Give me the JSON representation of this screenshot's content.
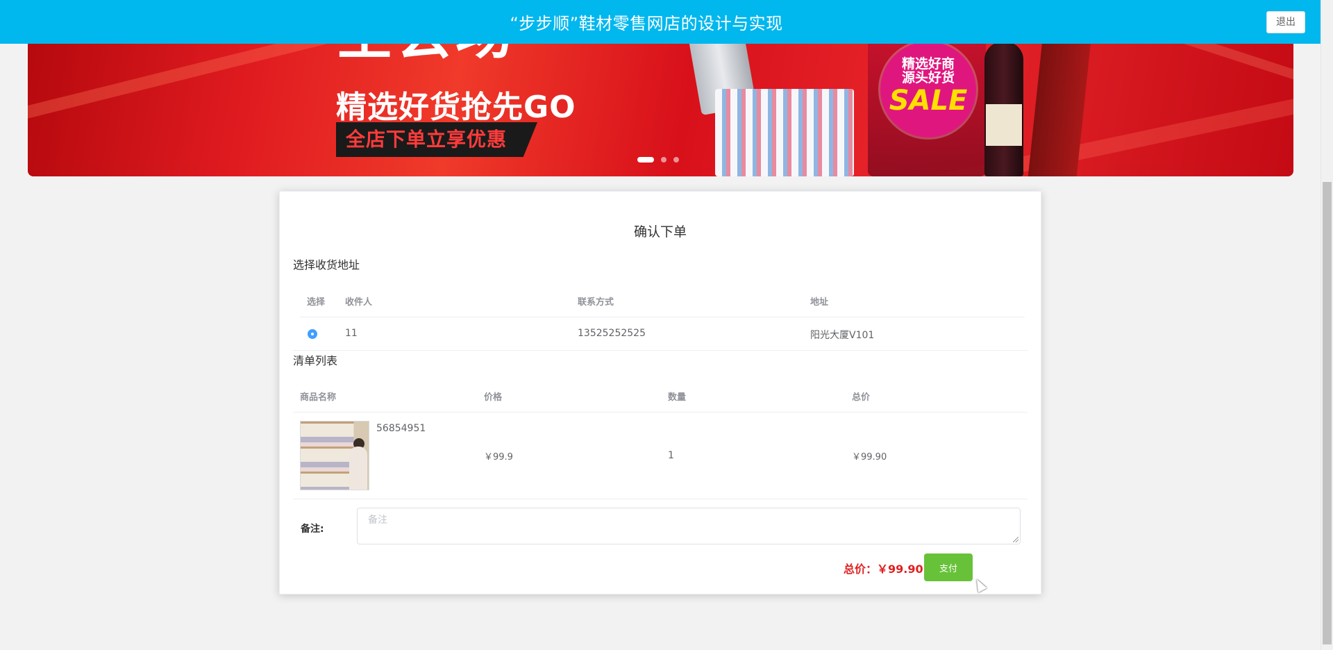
{
  "header": {
    "title": "“步步顺”鞋材零售网店的设计与实现",
    "logout_label": "退出",
    "background_color": "#00b7ee"
  },
  "banner": {
    "big_text": "全会场",
    "headline": "精选好货抢先GO",
    "strip_text": "全店下单立享优惠",
    "badge_line1": "精选好商",
    "badge_line2": "源头好货",
    "badge_sale": "SALE",
    "carousel_dots": 3,
    "active_dot": 1
  },
  "order": {
    "title": "确认下单",
    "address_section_title": "选择收货地址",
    "address_columns": [
      "选择",
      "收件人",
      "联系方式",
      "地址"
    ],
    "addresses": [
      {
        "selected": true,
        "recipient": "11",
        "phone": "13525252525",
        "address": "阳光大厦V101"
      }
    ],
    "list_section_title": "清单列表",
    "list_columns": [
      "商品名称",
      "价格",
      "数量",
      "总价"
    ],
    "items": [
      {
        "name": "56854951",
        "price": "￥99.9",
        "quantity": "1",
        "total": "￥99.90"
      }
    ],
    "remark_label": "备注:",
    "remark_placeholder": "备注",
    "total_label": "总价：￥99.90",
    "pay_label": "支付",
    "accent_color": "#409eff",
    "pay_color": "#67c23a",
    "total_color": "#e02020"
  }
}
